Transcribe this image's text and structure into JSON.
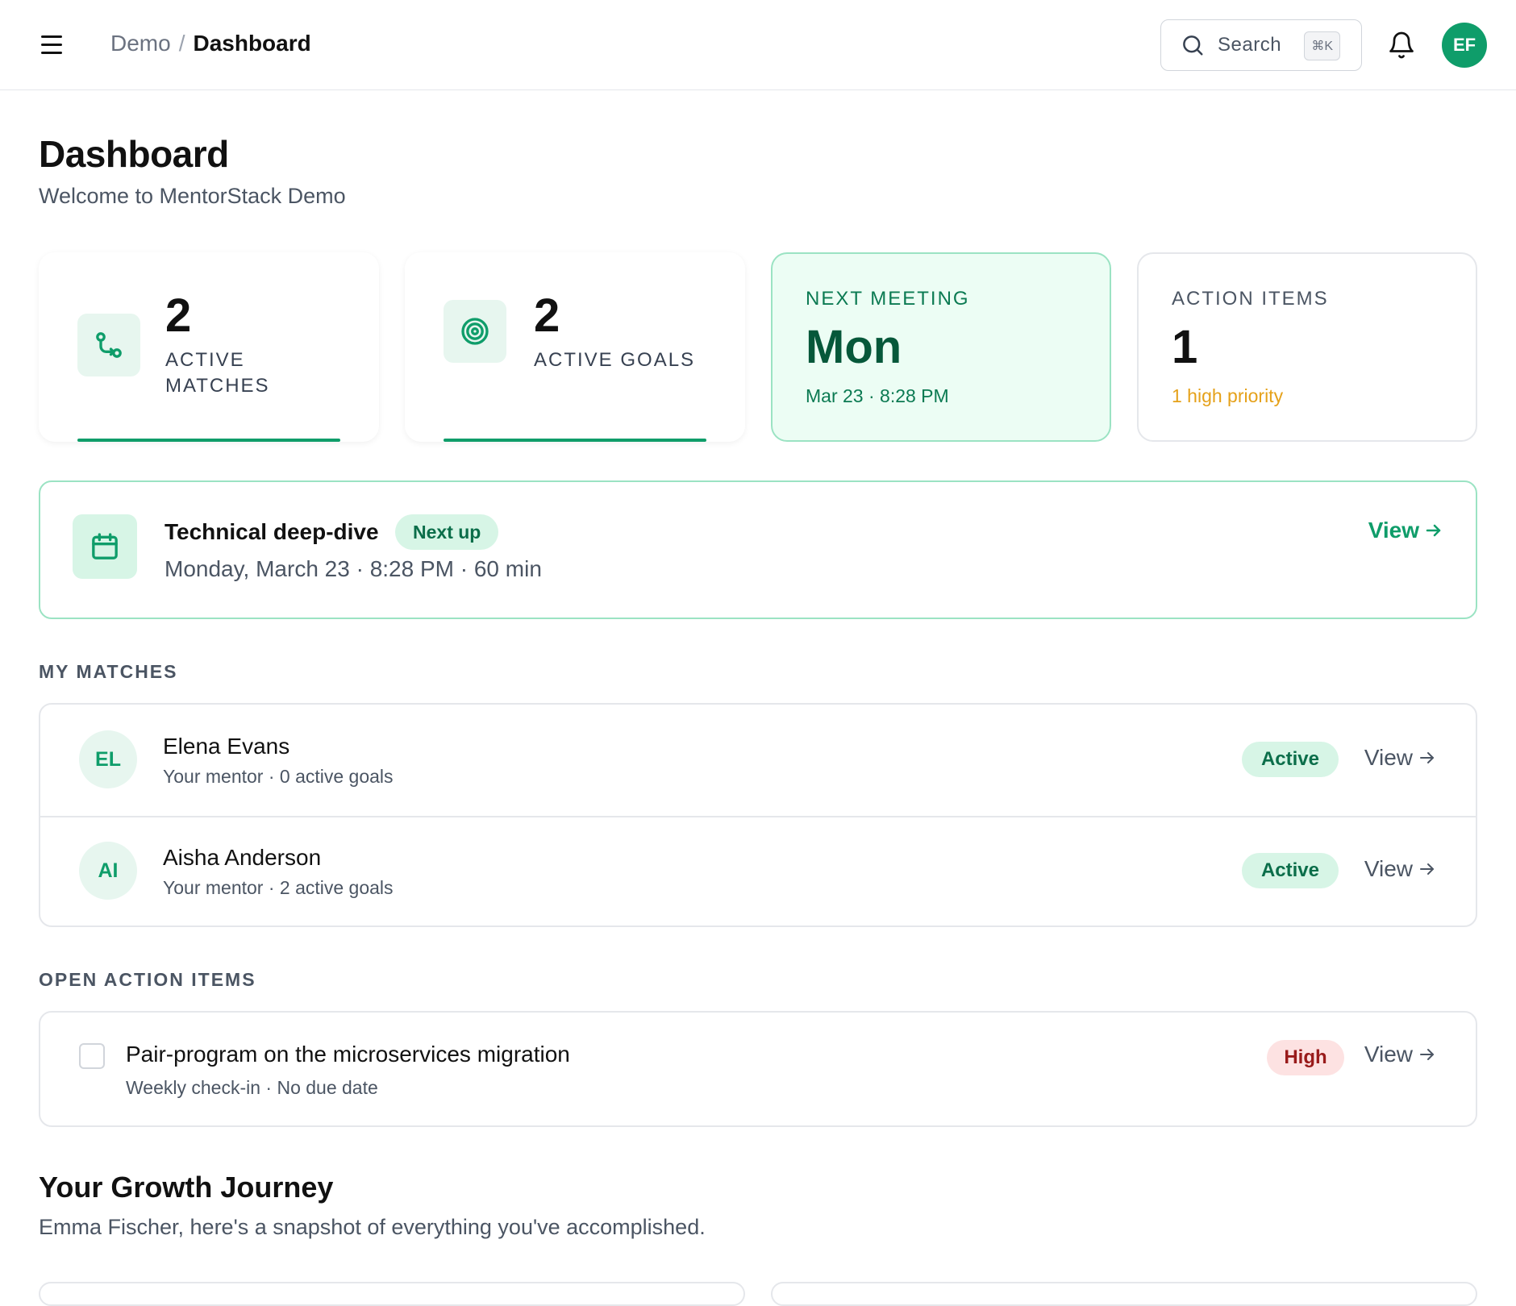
{
  "topbar": {
    "breadcrumb_root": "Demo",
    "breadcrumb_sep": "/",
    "breadcrumb_current": "Dashboard",
    "search_label": "Search",
    "search_shortcut": "⌘K",
    "user_initials": "EF"
  },
  "header": {
    "title": "Dashboard",
    "subtitle": "Welcome to MentorStack Demo"
  },
  "stats": {
    "matches": {
      "value": "2",
      "label": "ACTIVE MATCHES",
      "icon": "git-compare-icon"
    },
    "goals": {
      "value": "2",
      "label": "ACTIVE GOALS",
      "icon": "target-icon"
    },
    "next_meeting": {
      "caption": "NEXT MEETING",
      "day": "Mon",
      "detail": "Mar 23 · 8:28 PM"
    },
    "action_items": {
      "caption": "ACTION ITEMS",
      "value": "1",
      "detail": "1 high priority"
    }
  },
  "upcoming_meeting": {
    "title": "Technical deep-dive",
    "badge": "Next up",
    "meta": "Monday, March 23 · 8:28 PM · 60 min",
    "view_label": "View",
    "icon": "calendar-icon"
  },
  "matches_section": {
    "label": "MY MATCHES",
    "items": [
      {
        "initials": "EL",
        "name": "Elena Evans",
        "sub": "Your mentor · 0 active goals",
        "status": "Active",
        "view_label": "View"
      },
      {
        "initials": "AI",
        "name": "Aisha Anderson",
        "sub": "Your mentor · 2 active goals",
        "status": "Active",
        "view_label": "View"
      }
    ]
  },
  "actions_section": {
    "label": "OPEN ACTION ITEMS",
    "items": [
      {
        "title": "Pair-program on the microservices migration",
        "sub": "Weekly check-in · No due date",
        "priority": "High",
        "view_label": "View"
      }
    ]
  },
  "growth": {
    "title": "Your Growth Journey",
    "subtitle": "Emma Fischer, here's a snapshot of everything you've accomplished."
  },
  "colors": {
    "accent": "#0f9d6a",
    "accent_light": "#d7f5e6",
    "warning": "#e5a11a",
    "danger_bg": "#fde2e2",
    "danger_text": "#991b1b"
  }
}
